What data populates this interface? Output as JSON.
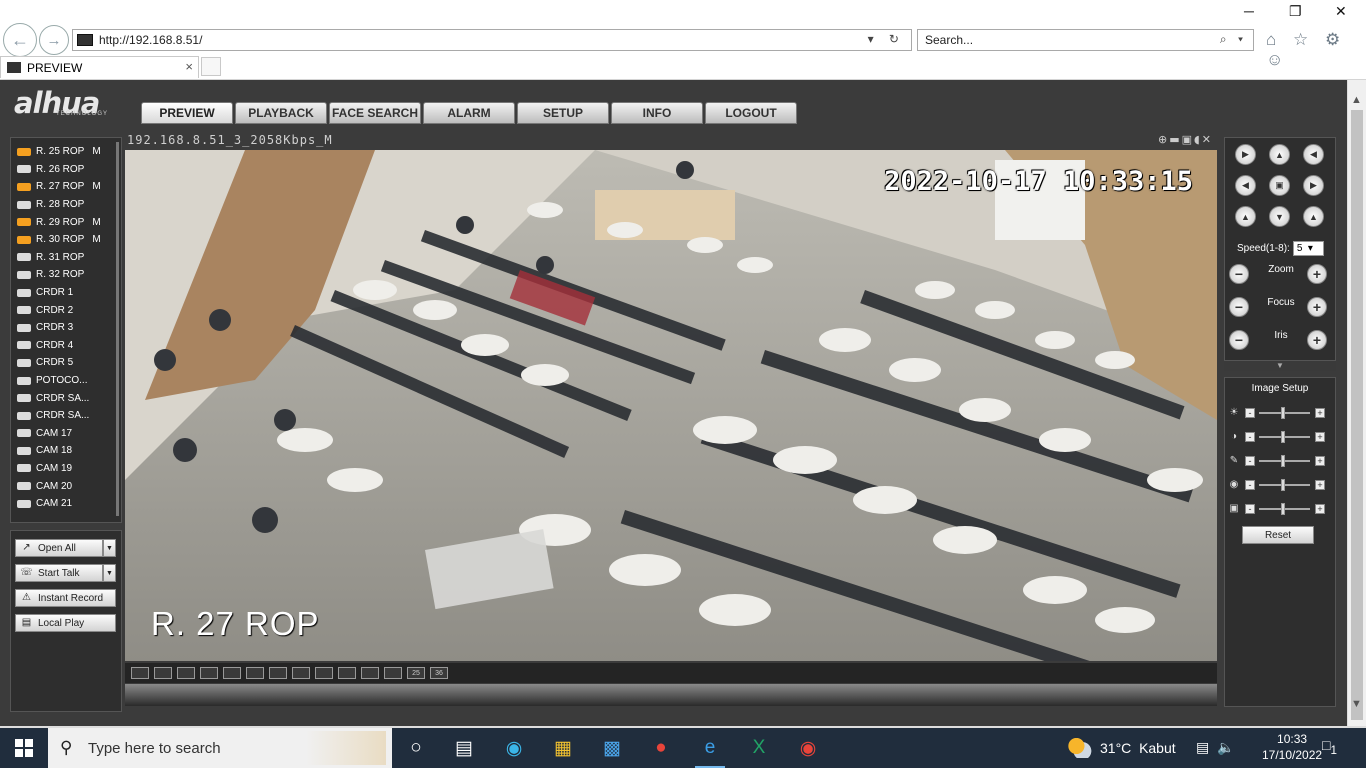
{
  "browser": {
    "url": "http://192.168.8.51/",
    "search_placeholder": "Search...",
    "tab_title": "PREVIEW",
    "tab_close": "×",
    "minimize": "─",
    "restore": "❐",
    "close": "✕",
    "addr_controls": "▾ ↻",
    "search_controls": "⌕ ▾",
    "toolbar_icons": "⌂ ☆ ⚙ ☺"
  },
  "app": {
    "logo": "alhua",
    "logo_sub": "TECHNOLOGY",
    "menu": [
      "PREVIEW",
      "PLAYBACK",
      "FACE SEARCH",
      "ALARM",
      "SETUP",
      "INFO",
      "LOGOUT"
    ],
    "active_menu": "PREVIEW"
  },
  "channels": [
    {
      "name": "R. 25 ROP",
      "flag": "M",
      "recording": true
    },
    {
      "name": "R. 26 ROP",
      "flag": "",
      "recording": false
    },
    {
      "name": "R. 27 ROP",
      "flag": "M",
      "recording": true
    },
    {
      "name": "R. 28 ROP",
      "flag": "",
      "recording": false
    },
    {
      "name": "R. 29 ROP",
      "flag": "M",
      "recording": true
    },
    {
      "name": "R. 30 ROP",
      "flag": "M",
      "recording": true
    },
    {
      "name": "R. 31 ROP",
      "flag": "",
      "recording": false
    },
    {
      "name": "R. 32 ROP",
      "flag": "",
      "recording": false
    },
    {
      "name": "CRDR 1",
      "flag": "",
      "recording": false
    },
    {
      "name": "CRDR 2",
      "flag": "",
      "recording": false
    },
    {
      "name": "CRDR 3",
      "flag": "",
      "recording": false
    },
    {
      "name": "CRDR 4",
      "flag": "",
      "recording": false
    },
    {
      "name": "CRDR 5",
      "flag": "",
      "recording": false
    },
    {
      "name": "POTOCO...",
      "flag": "",
      "recording": false
    },
    {
      "name": "CRDR SA...",
      "flag": "",
      "recording": false
    },
    {
      "name": "CRDR SA...",
      "flag": "",
      "recording": false
    },
    {
      "name": "CAM 17",
      "flag": "",
      "recording": false
    },
    {
      "name": "CAM 18",
      "flag": "",
      "recording": false
    },
    {
      "name": "CAM 19",
      "flag": "",
      "recording": false
    },
    {
      "name": "CAM 20",
      "flag": "",
      "recording": false
    },
    {
      "name": "CAM 21",
      "flag": "",
      "recording": false
    }
  ],
  "controls": {
    "open_all": "Open All",
    "start_talk": "Start Talk",
    "instant_record": "Instant Record",
    "local_play": "Local Play"
  },
  "video": {
    "stream_info": "192.168.8.51_3_2058Kbps_M",
    "tools": "⊕▬▣◖✕",
    "timestamp": "2022-10-17 10:33:15",
    "channel_overlay": "R. 27 ROP",
    "layout_buttons": [
      "",
      "",
      "",
      "",
      "",
      "",
      "",
      "",
      "",
      "",
      "",
      "",
      "25",
      "36"
    ]
  },
  "ptz": {
    "speed_label": "Speed(1-8):",
    "speed_value": "5",
    "zoom": "Zoom",
    "focus": "Focus",
    "iris": "Iris"
  },
  "image_setup": {
    "title": "Image Setup",
    "reset": "Reset",
    "sliders": [
      "brightness-icon",
      "contrast-icon",
      "saturation-icon",
      "hue-icon",
      "sharpness-icon"
    ]
  },
  "taskbar": {
    "search_placeholder": "Type here to search",
    "temperature": "31°C",
    "weather": "Kabut",
    "time": "10:33",
    "date": "17/10/2022",
    "notifications": "1"
  }
}
